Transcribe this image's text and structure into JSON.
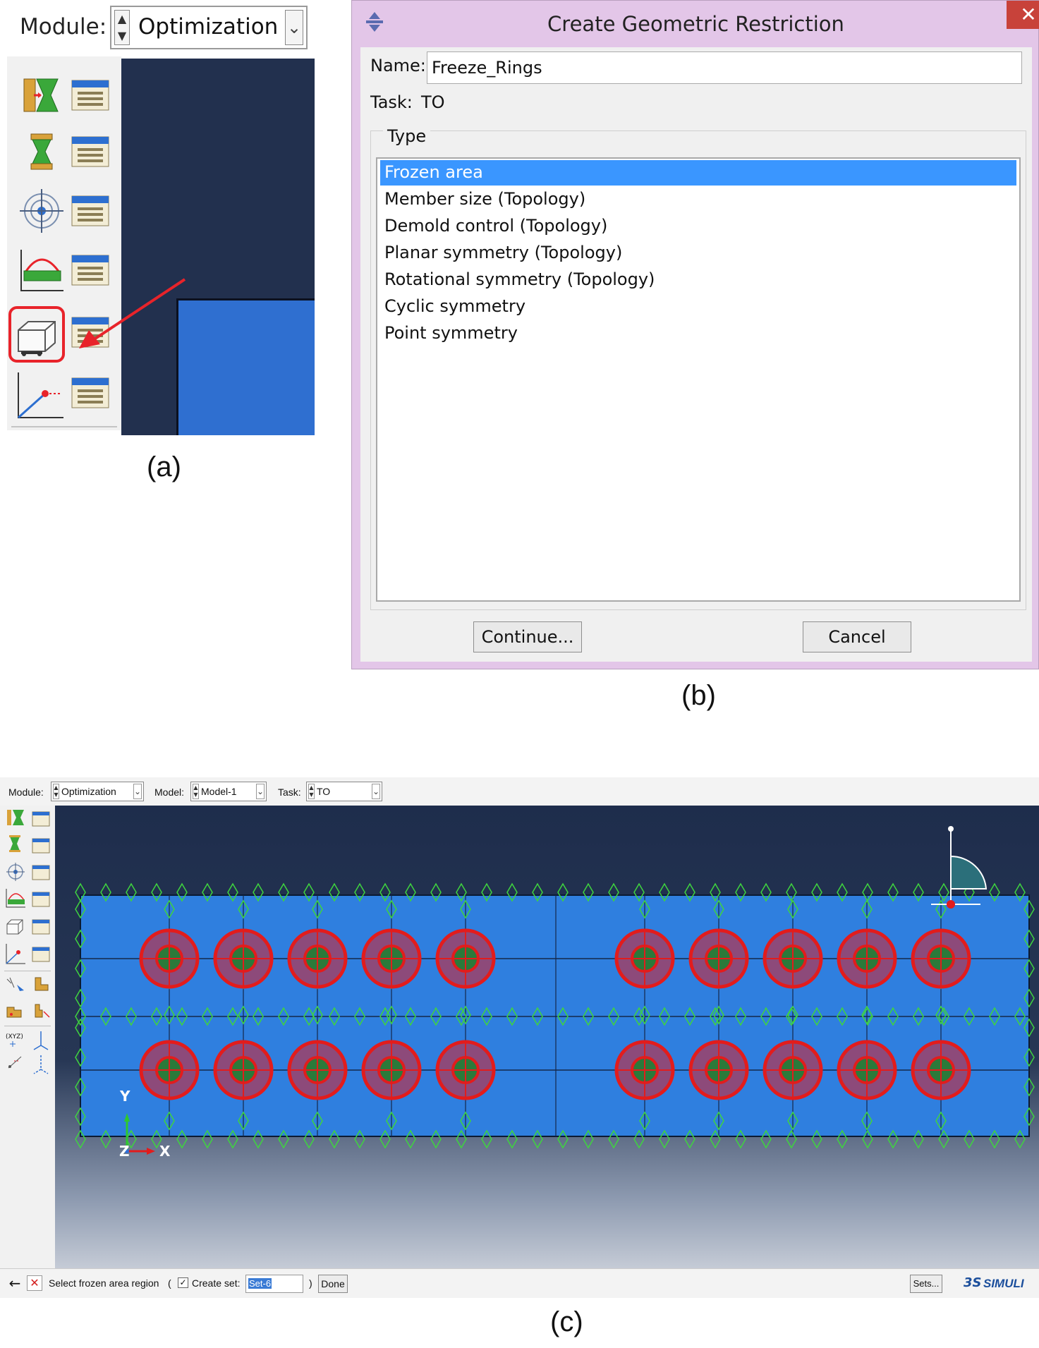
{
  "panel_a": {
    "module_label": "Module:",
    "module_value": "Optimization",
    "caption": "(a)",
    "tools": [
      {
        "icon": "create-task-icon"
      },
      {
        "icon": "create-design-response-icon"
      },
      {
        "icon": "create-objective-function-icon"
      },
      {
        "icon": "create-constraint-icon"
      },
      {
        "icon": "create-geometric-restriction-icon",
        "highlighted": true
      },
      {
        "icon": "create-stop-condition-icon"
      }
    ],
    "highlight_color": "#e8232a",
    "arrow_color": "#e8232a"
  },
  "dialog": {
    "title": "Create Geometric Restriction",
    "close_glyph": "✕",
    "name_label": "Name:",
    "name_value": "Freeze_Rings",
    "task_label": "Task:",
    "task_value": "TO",
    "type_label": "Type",
    "types": [
      "Frozen area",
      "Member size (Topology)",
      "Demold control (Topology)",
      "Planar symmetry (Topology)",
      "Rotational symmetry (Topology)",
      "Cyclic symmetry",
      "Point symmetry"
    ],
    "selected_type": "Frozen area",
    "continue_label": "Continue...",
    "cancel_label": "Cancel",
    "caption": "(b)",
    "selection_color": "#3a96ff",
    "title_bar_color": "#e3c6e8",
    "close_color": "#c8423a"
  },
  "panel_c": {
    "module_label": "Module:",
    "module_value": "Optimization",
    "model_label": "Model:",
    "model_value": "Model-1",
    "task_label": "Task:",
    "task_value": "TO",
    "axis_x": "X",
    "axis_y": "Y",
    "axis_z": "Z",
    "prompt_text": "Select frozen area region",
    "paren_open": "(",
    "paren_close": ")",
    "create_set_label": "Create set:",
    "create_set_checked": true,
    "set_name": "Set-6",
    "done_label": "Done",
    "sets_label": "Sets...",
    "brand_text": "SIMULI",
    "brand_logo_text": "3S",
    "caption": "(c)",
    "part_color": "#2f7fdf",
    "ring_color": "#e21c1c",
    "mesh_color": "#3fd43f",
    "rings_per_row": 10
  }
}
